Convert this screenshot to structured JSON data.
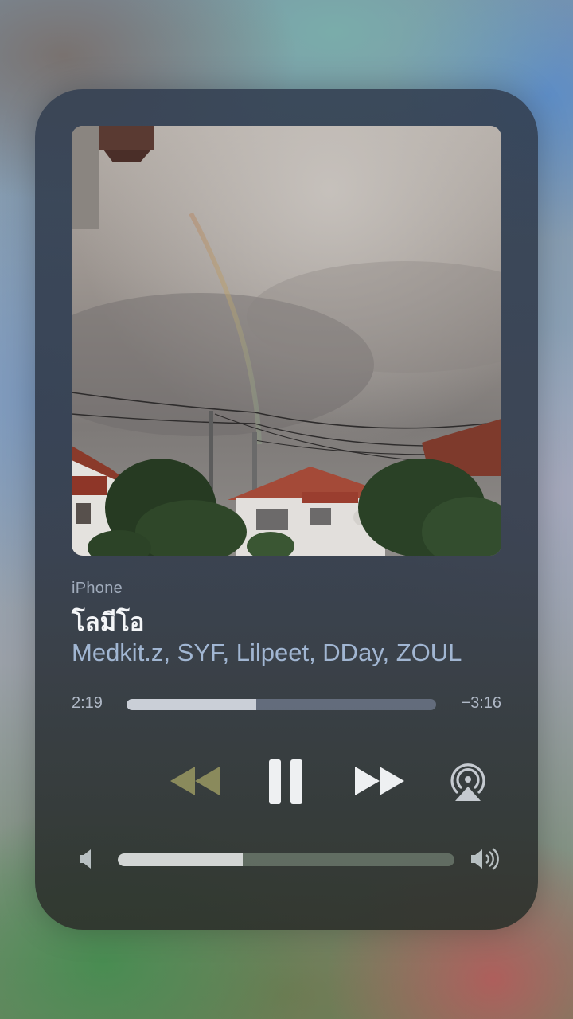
{
  "player": {
    "source": "iPhone",
    "title": "โลมีโอ",
    "artist": "Medkit.z, SYF, Lilpeet, DDay, ZOUL",
    "elapsed": "2:19",
    "remaining": "−3:16",
    "progress_fraction": 0.42,
    "is_playing": true
  },
  "volume": {
    "level_fraction": 0.37
  },
  "icons": {
    "rewind": "rewind-icon",
    "pause": "pause-icon",
    "forward": "fast-forward-icon",
    "airplay": "airplay-icon",
    "volume_low": "speaker-low-icon",
    "volume_high": "speaker-high-icon"
  },
  "colors": {
    "title": "#f4f6f8",
    "artist": "#aac0de",
    "rewind_disabled": "#8a8a5c"
  }
}
